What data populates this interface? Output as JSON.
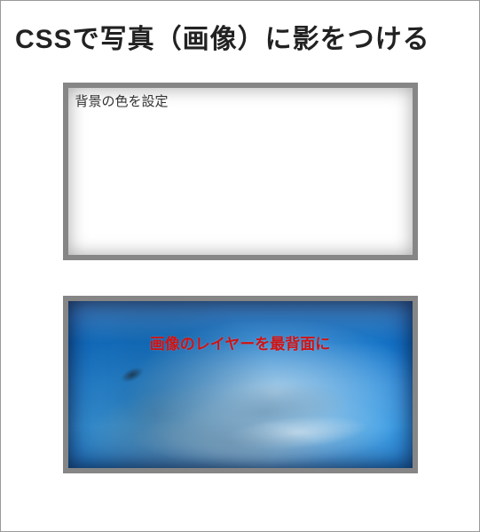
{
  "title": "CSSで写真（画像）に影をつける",
  "box1": {
    "label": "背景の色を設定"
  },
  "box2": {
    "label": "画像のレイヤーを最背面に"
  }
}
